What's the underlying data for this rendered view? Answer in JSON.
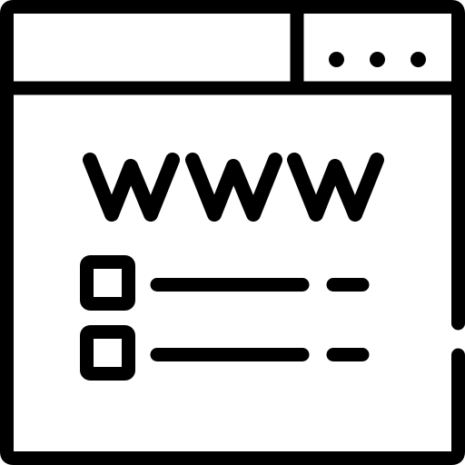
{
  "icon": {
    "name": "website-browser-icon",
    "color": "#000000",
    "background": "#ffffff"
  },
  "window_controls": {
    "dot_count": 3
  },
  "address_text": "WWW",
  "list": {
    "items": [
      {
        "checkbox": "checkbox-icon"
      },
      {
        "checkbox": "checkbox-icon"
      }
    ]
  }
}
